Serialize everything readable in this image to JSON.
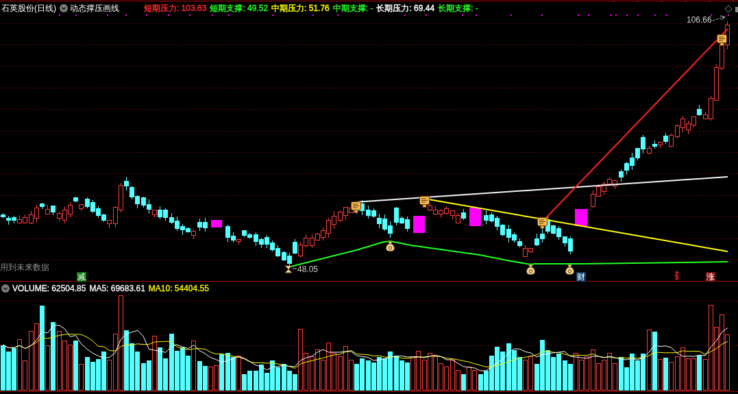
{
  "chart_header": {
    "title": "石英股份(日线)",
    "indicator": "动态撑压画线",
    "legend": [
      {
        "text": "短期压力: 103.63",
        "color": "#ff2b2b"
      },
      {
        "text": "短期支撑: 49.52",
        "color": "#22ff22"
      },
      {
        "text": "中期压力: 51.76",
        "color": "#ffff00"
      },
      {
        "text": "中期支撑: -",
        "color": "#22ff22"
      },
      {
        "text": "长期压力: 69.44",
        "color": "#ffffff"
      },
      {
        "text": "长期支撑: -",
        "color": "#22ff22"
      }
    ]
  },
  "price_chart": {
    "high_label": "106.66",
    "low_label": "48.05",
    "note": "用到未来数据",
    "signals": [
      {
        "kind": "tag",
        "text": "减",
        "color": "#0a7d0a"
      },
      {
        "kind": "tag",
        "text": "财",
        "color": "#10406e"
      },
      {
        "kind": "arrow",
        "text": "$",
        "color": "#ff2020"
      },
      {
        "kind": "tag",
        "text": "涨",
        "color": "#800c0c"
      }
    ]
  },
  "volume_panel": {
    "readings": [
      {
        "text": "VOLUME: 62504.85",
        "color": "#ffffff"
      },
      {
        "text": "MA5: 69683.61",
        "color": "#ffffff"
      },
      {
        "text": "MA10: 54404.55",
        "color": "#ffff00"
      }
    ]
  }
}
